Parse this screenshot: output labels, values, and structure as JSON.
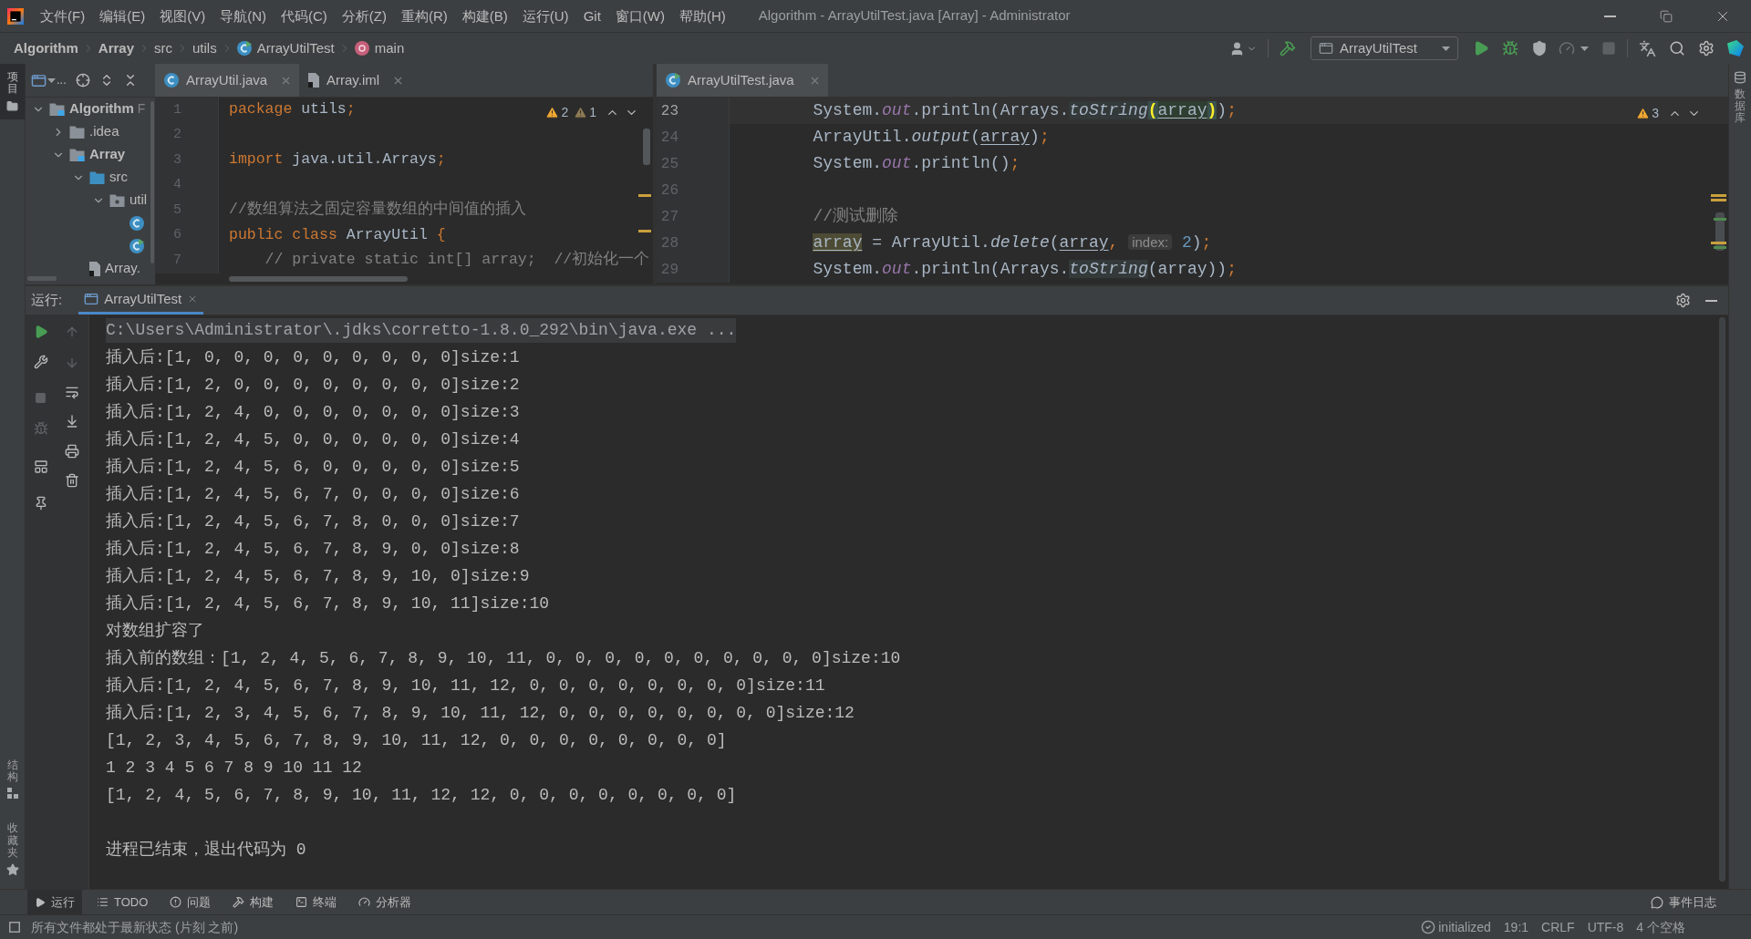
{
  "title_bar": {
    "menu": [
      "文件(F)",
      "编辑(E)",
      "视图(V)",
      "导航(N)",
      "代码(C)",
      "分析(Z)",
      "重构(R)",
      "构建(B)",
      "运行(U)",
      "Git",
      "窗口(W)",
      "帮助(H)"
    ],
    "title": "Algorithm - ArrayUtilTest.java [Array] - Administrator"
  },
  "nav_bar": {
    "breadcrumbs": [
      {
        "label": "Algorithm",
        "kind": "module"
      },
      {
        "label": "Array",
        "kind": "module"
      },
      {
        "label": "src",
        "kind": "folder"
      },
      {
        "label": "utils",
        "kind": "folder"
      },
      {
        "label": "ArrayUtilTest",
        "kind": "test_class"
      },
      {
        "label": "main",
        "kind": "method"
      }
    ],
    "run_config": "ArrayUtilTest"
  },
  "left_strip": {
    "top": [
      {
        "label": "项目",
        "selected": true
      }
    ],
    "bottom": [
      {
        "label": "结构",
        "kind": "structure"
      },
      {
        "label": "收藏夹",
        "kind": "favorites"
      }
    ]
  },
  "project_panel": {
    "view_label": "...",
    "tree": [
      {
        "label": "Algorithm",
        "hint": "F",
        "kind": "module",
        "expanded": true,
        "children": [
          {
            "label": ".idea",
            "kind": "folder",
            "expanded": false
          },
          {
            "label": "Array",
            "kind": "module",
            "expanded": true,
            "children": [
              {
                "label": "src",
                "kind": "source_folder",
                "expanded": true,
                "children": [
                  {
                    "label": "util",
                    "kind": "package",
                    "expanded": true,
                    "children": [
                      {
                        "kind": "class"
                      },
                      {
                        "kind": "test_class"
                      }
                    ]
                  }
                ]
              },
              {
                "label": "Array.",
                "kind": "iml"
              }
            ]
          }
        ]
      }
    ]
  },
  "editor_left": {
    "tabs": [
      {
        "label": "ArrayUtil.java",
        "kind": "class",
        "selected": true
      },
      {
        "label": "Array.iml",
        "kind": "iml",
        "selected": false
      }
    ],
    "inspections": [
      {
        "kind": "warning",
        "count": "2"
      },
      {
        "kind": "weak_warning",
        "count": "1"
      }
    ],
    "lines": [
      {
        "number": "1",
        "current": false,
        "tokens": [
          {
            "kind": "keyword",
            "text": "package"
          },
          {
            "kind": "plain",
            "text": " utils"
          },
          {
            "kind": "punct",
            "text": ";"
          }
        ]
      },
      {
        "number": "2",
        "current": false
      },
      {
        "number": "3",
        "current": false,
        "tokens": [
          {
            "kind": "keyword",
            "text": "import"
          },
          {
            "kind": "plain",
            "text": " java.util.Arrays"
          },
          {
            "kind": "punct",
            "text": ";"
          }
        ]
      },
      {
        "number": "4",
        "current": false
      },
      {
        "number": "5",
        "current": false,
        "tokens": [
          {
            "kind": "comment",
            "text": "//数组算法之固定容量数组的中间值的插入"
          }
        ]
      },
      {
        "number": "6",
        "current": false,
        "tokens": [
          {
            "kind": "keyword",
            "text": "public class"
          },
          {
            "kind": "plain",
            "text": " ArrayUtil "
          },
          {
            "kind": "punct",
            "text": "{"
          }
        ]
      },
      {
        "number": "7",
        "current": false,
        "tokens": [
          {
            "kind": "comment",
            "text": "    // private static int[] array;  //初始化一个"
          }
        ]
      }
    ]
  },
  "editor_right": {
    "tabs": [
      {
        "label": "ArrayUtilTest.java",
        "kind": "test_class",
        "selected": true
      }
    ],
    "inspections": [
      {
        "kind": "warning",
        "count": "3"
      }
    ],
    "lines": [
      {
        "number": "23",
        "current": true,
        "tokens": [
          {
            "kind": "plain",
            "text": "        System."
          },
          {
            "kind": "field",
            "text": "out"
          },
          {
            "kind": "plain",
            "text": ".println(Arrays."
          },
          {
            "kind": "method_hl",
            "text": "toString"
          },
          {
            "kind": "brace",
            "text": "("
          },
          {
            "kind": "var_hl",
            "text": "array"
          },
          {
            "kind": "brace",
            "text": ")"
          },
          {
            "kind": "plain",
            "text": ")"
          },
          {
            "kind": "punct",
            "text": ";"
          }
        ]
      },
      {
        "number": "24",
        "current": false,
        "tokens": [
          {
            "kind": "plain",
            "text": "        ArrayUtil."
          },
          {
            "kind": "method",
            "text": "output"
          },
          {
            "kind": "plain",
            "text": "("
          },
          {
            "kind": "var",
            "text": "array"
          },
          {
            "kind": "plain",
            "text": ")"
          },
          {
            "kind": "punct",
            "text": ";"
          }
        ]
      },
      {
        "number": "25",
        "current": false,
        "tokens": [
          {
            "kind": "plain",
            "text": "        System."
          },
          {
            "kind": "field",
            "text": "out"
          },
          {
            "kind": "plain",
            "text": ".println()"
          },
          {
            "kind": "punct",
            "text": ";"
          }
        ]
      },
      {
        "number": "26",
        "current": false
      },
      {
        "number": "27",
        "current": false,
        "tokens": [
          {
            "kind": "comment",
            "text": "        //测试删除"
          }
        ]
      },
      {
        "number": "28",
        "current": false,
        "tokens": [
          {
            "kind": "usage",
            "text": "        array"
          },
          {
            "kind": "plain",
            "text": " = ArrayUtil."
          },
          {
            "kind": "method",
            "text": "delete"
          },
          {
            "kind": "plain",
            "text": "("
          },
          {
            "kind": "var",
            "text": "array"
          },
          {
            "kind": "punct",
            "text": ", "
          },
          {
            "kind": "hint",
            "text": "index:"
          },
          {
            "kind": "number",
            "text": " 2"
          },
          {
            "kind": "plain",
            "text": ")"
          },
          {
            "kind": "punct",
            "text": ";"
          }
        ]
      },
      {
        "number": "29",
        "current": false,
        "tokens": [
          {
            "kind": "plain",
            "text": "        System."
          },
          {
            "kind": "field",
            "text": "out"
          },
          {
            "kind": "plain",
            "text": ".println(Arrays."
          },
          {
            "kind": "method_hl",
            "text": "toString"
          },
          {
            "kind": "plain",
            "text": "(array))"
          },
          {
            "kind": "punct",
            "text": ";"
          }
        ]
      }
    ]
  },
  "right_strip": [
    {
      "label": "数据库",
      "kind": "database"
    }
  ],
  "run_panel": {
    "label": "运行:",
    "tabs": [
      {
        "label": "ArrayUtilTest",
        "selected": true
      }
    ],
    "console": [
      {
        "kind": "command",
        "text": "C:\\Users\\Administrator\\.jdks\\corretto-1.8.0_292\\bin\\java.exe ..."
      },
      {
        "kind": "output",
        "text": "插入后:[1, 0, 0, 0, 0, 0, 0, 0, 0, 0]size:1"
      },
      {
        "kind": "output",
        "text": "插入后:[1, 2, 0, 0, 0, 0, 0, 0, 0, 0]size:2"
      },
      {
        "kind": "output",
        "text": "插入后:[1, 2, 4, 0, 0, 0, 0, 0, 0, 0]size:3"
      },
      {
        "kind": "output",
        "text": "插入后:[1, 2, 4, 5, 0, 0, 0, 0, 0, 0]size:4"
      },
      {
        "kind": "output",
        "text": "插入后:[1, 2, 4, 5, 6, 0, 0, 0, 0, 0]size:5"
      },
      {
        "kind": "output",
        "text": "插入后:[1, 2, 4, 5, 6, 7, 0, 0, 0, 0]size:6"
      },
      {
        "kind": "output",
        "text": "插入后:[1, 2, 4, 5, 6, 7, 8, 0, 0, 0]size:7"
      },
      {
        "kind": "output",
        "text": "插入后:[1, 2, 4, 5, 6, 7, 8, 9, 0, 0]size:8"
      },
      {
        "kind": "output",
        "text": "插入后:[1, 2, 4, 5, 6, 7, 8, 9, 10, 0]size:9"
      },
      {
        "kind": "output",
        "text": "插入后:[1, 2, 4, 5, 6, 7, 8, 9, 10, 11]size:10"
      },
      {
        "kind": "output",
        "text": "对数组扩容了"
      },
      {
        "kind": "output",
        "text": "插入前的数组：[1, 2, 4, 5, 6, 7, 8, 9, 10, 11, 0, 0, 0, 0, 0, 0, 0, 0, 0, 0]size:10"
      },
      {
        "kind": "output",
        "text": "插入后:[1, 2, 4, 5, 6, 7, 8, 9, 10, 11, 12, 0, 0, 0, 0, 0, 0, 0, 0]size:11"
      },
      {
        "kind": "output",
        "text": "插入后:[1, 2, 3, 4, 5, 6, 7, 8, 9, 10, 11, 12, 0, 0, 0, 0, 0, 0, 0, 0]size:12"
      },
      {
        "kind": "output",
        "text": "[1, 2, 3, 4, 5, 6, 7, 8, 9, 10, 11, 12, 0, 0, 0, 0, 0, 0, 0, 0]"
      },
      {
        "kind": "output",
        "text": "1 2 3 4 5 6 7 8 9 10 11 12"
      },
      {
        "kind": "output",
        "text": "[1, 2, 4, 5, 6, 7, 8, 9, 10, 11, 12, 12, 0, 0, 0, 0, 0, 0, 0, 0]"
      },
      {
        "kind": "exit",
        "text": "进程已结束，退出代码为 0"
      }
    ]
  },
  "tool_windows": {
    "left": [
      {
        "label": "运行",
        "kind": "run",
        "selected": true
      },
      {
        "label": "TODO",
        "kind": "todo",
        "selected": false
      },
      {
        "label": "问题",
        "kind": "problems",
        "selected": false
      },
      {
        "label": "构建",
        "kind": "build",
        "selected": false
      },
      {
        "label": "终端",
        "kind": "terminal",
        "selected": false
      },
      {
        "label": "分析器",
        "kind": "profiler",
        "selected": false
      }
    ],
    "right": [
      {
        "label": "事件日志",
        "kind": "event_log",
        "selected": false
      }
    ]
  },
  "status_bar": {
    "message": "所有文件都处于最新状态 (片刻 之前)",
    "items": [
      {
        "kind": "status",
        "label": "initialized"
      },
      {
        "kind": "text",
        "label": "19:1"
      },
      {
        "kind": "text",
        "label": "CRLF"
      },
      {
        "kind": "text",
        "label": "UTF-8"
      },
      {
        "kind": "text",
        "label": "4 个空格"
      }
    ]
  }
}
